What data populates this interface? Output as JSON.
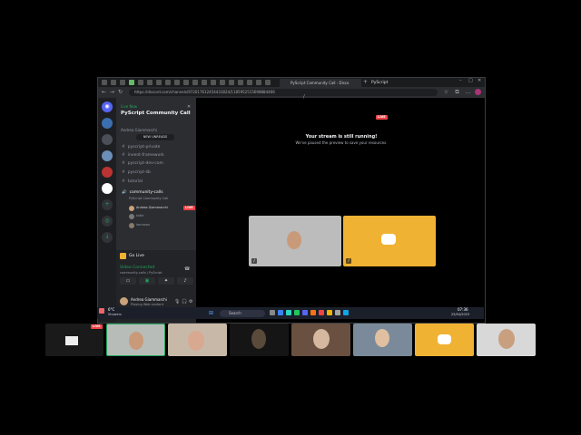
{
  "browser": {
    "tab_title": "PyScript Community Call - Disco",
    "url": "https://discord.com/channels/972017612454431824/1185952515698884466",
    "channel_header": "PyScript"
  },
  "sidebar": {
    "server_title": "PyScript Community Call",
    "live_now": "Live Now",
    "speaker_line": "Andrea Giammarchi",
    "banner": "NEW UNREADS",
    "channels": [
      {
        "name": "pyscript-private"
      },
      {
        "name": "invent-framework"
      },
      {
        "name": "pyscript-dev-com"
      },
      {
        "name": "pyscript-lib"
      },
      {
        "name": "tutorial"
      }
    ],
    "voice_channel": "community-calls",
    "voice_sub": "PyScript Community Call",
    "participants": [
      {
        "name": "Andrea Giammarchi",
        "badge": "LIVE"
      },
      {
        "name": "kidle"
      },
      {
        "name": "ianroxon"
      }
    ],
    "go_live": "Go Live",
    "connected_title": "Video Connected",
    "connected_sub": "community-calls / PyScript",
    "user_name": "Andrea Giammarchi",
    "user_status": "Playing Web content"
  },
  "stage": {
    "live_badge": "LIVE",
    "message_title": "Your stream is still running!",
    "message_sub": "We've paused the preview to save your resources."
  },
  "taskbar": {
    "weather_temp": "6°C",
    "weather_desc": "Showers",
    "search": "Search",
    "time": "07:36",
    "date": "25/04/2023"
  },
  "strip": {
    "live_badge": "LIVE"
  },
  "colors": {
    "discord_bg": "#313338",
    "discord_yellow": "#f0b232",
    "live_red": "#ed4245",
    "online_green": "#23a55a"
  }
}
